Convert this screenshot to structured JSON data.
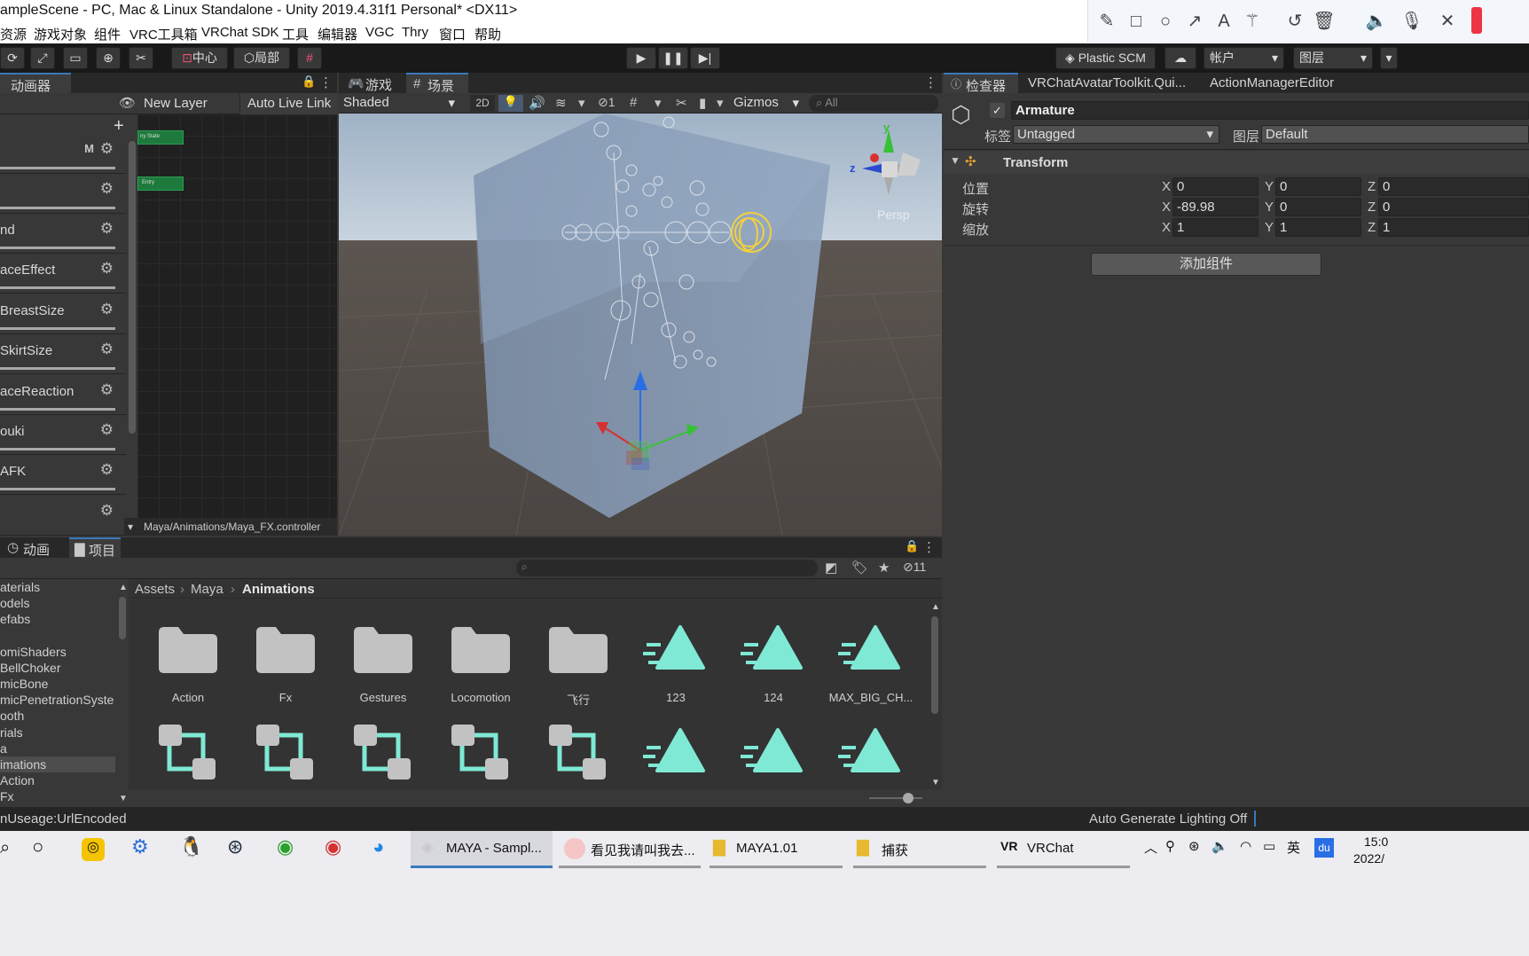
{
  "window": {
    "title": "ampleScene - PC, Mac & Linux Standalone - Unity 2019.4.31f1 Personal* <DX11>"
  },
  "menu": [
    "资源",
    "游戏对象",
    "组件",
    "VRC工具箱",
    "VRChat SDK",
    "工具",
    "编辑器",
    "VGC",
    "Thry",
    "窗口",
    "帮助"
  ],
  "annotation_tools": [
    "pencil-icon",
    "rectangle-icon",
    "circle-icon",
    "arrow-icon",
    "text-icon",
    "magic-wand-icon",
    "undo-icon",
    "trash-icon",
    "speaker-icon",
    "mic-icon",
    "close-icon"
  ],
  "toolbar": {
    "pivot_center": "中心",
    "pivot_local": "局部",
    "plastic": "Plastic SCM",
    "account": "帐户",
    "layers": "图层"
  },
  "animator": {
    "tab": "动画器",
    "new_layer": "New Layer",
    "auto_live_link": "Auto Live Link",
    "layer_badge": "M",
    "layers": [
      "",
      "",
      "nd",
      "aceEffect",
      "BreastSize",
      "SkirtSize",
      "aceReaction",
      "ouki",
      "AFK",
      ""
    ],
    "nodes": [
      "ny State",
      "Entry"
    ],
    "path": "Maya/Animations/Maya_FX.controller"
  },
  "scene": {
    "tab_game": "游戏",
    "tab_scene": "场景",
    "shading": "Shaded",
    "mode_2d": "2D",
    "hidden_count": "1",
    "gizmos": "Gizmos",
    "search_placeholder": "All",
    "persp": "Persp",
    "axis_y": "y",
    "axis_z": "z"
  },
  "inspector": {
    "tabs": [
      "检查器",
      "VRChatAvatarToolkit.Qui...",
      "ActionManagerEditor"
    ],
    "object_name": "Armature",
    "tag_label": "标签",
    "tag_value": "Untagged",
    "layer_label": "图层",
    "layer_value": "Default",
    "component": "Transform",
    "rows": [
      {
        "label": "位置",
        "x": "0",
        "y": "0",
        "z": "0"
      },
      {
        "label": "旋转",
        "x": "-89.98",
        "y": "0",
        "z": "0"
      },
      {
        "label": "缩放",
        "x": "1",
        "y": "1",
        "z": "1"
      }
    ],
    "axis_labels": {
      "x": "X",
      "y": "Y",
      "z": "Z"
    },
    "add_component": "添加组件"
  },
  "project": {
    "tab_animation": "动画",
    "tab_project": "项目",
    "hidden_count": "11",
    "breadcrumb": [
      "Assets",
      "Maya",
      "Animations"
    ],
    "tree": [
      "aterials",
      "odels",
      "efabs",
      "",
      "omiShaders",
      "BellChoker",
      "micBone",
      "micPenetrationSyste",
      "ooth",
      "rials",
      "a",
      "imations",
      "Action",
      "Fx"
    ],
    "items_row1": [
      {
        "label": "Action",
        "kind": "folder"
      },
      {
        "label": "Fx",
        "kind": "folder"
      },
      {
        "label": "Gestures",
        "kind": "folder"
      },
      {
        "label": "Locomotion",
        "kind": "folder"
      },
      {
        "label": "飞行",
        "kind": "folder"
      },
      {
        "label": "123",
        "kind": "anim"
      },
      {
        "label": "124",
        "kind": "anim"
      },
      {
        "label": "MAX_BIG_CH...",
        "kind": "anim"
      }
    ],
    "items_row2": [
      "controller",
      "controller",
      "controller",
      "controller",
      "controller",
      "anim",
      "anim",
      "anim"
    ]
  },
  "status": {
    "left": "nUseage:UrlEncoded",
    "right": "Auto Generate Lighting Off"
  },
  "taskbar": {
    "apps": [
      "MAYA - Sampl...",
      "看见我请叫我去...",
      "MAYA1.01",
      "捕获",
      "VRChat"
    ],
    "tray_lang": "英",
    "time": "15:0",
    "date": "2022/"
  },
  "colors": {
    "unity_dark": "#383838",
    "anim_teal": "#7fe9d5",
    "folder_gray": "#c2c2c2",
    "node_green": "#1d7a3c",
    "selection_yellow": "#f0d040"
  }
}
